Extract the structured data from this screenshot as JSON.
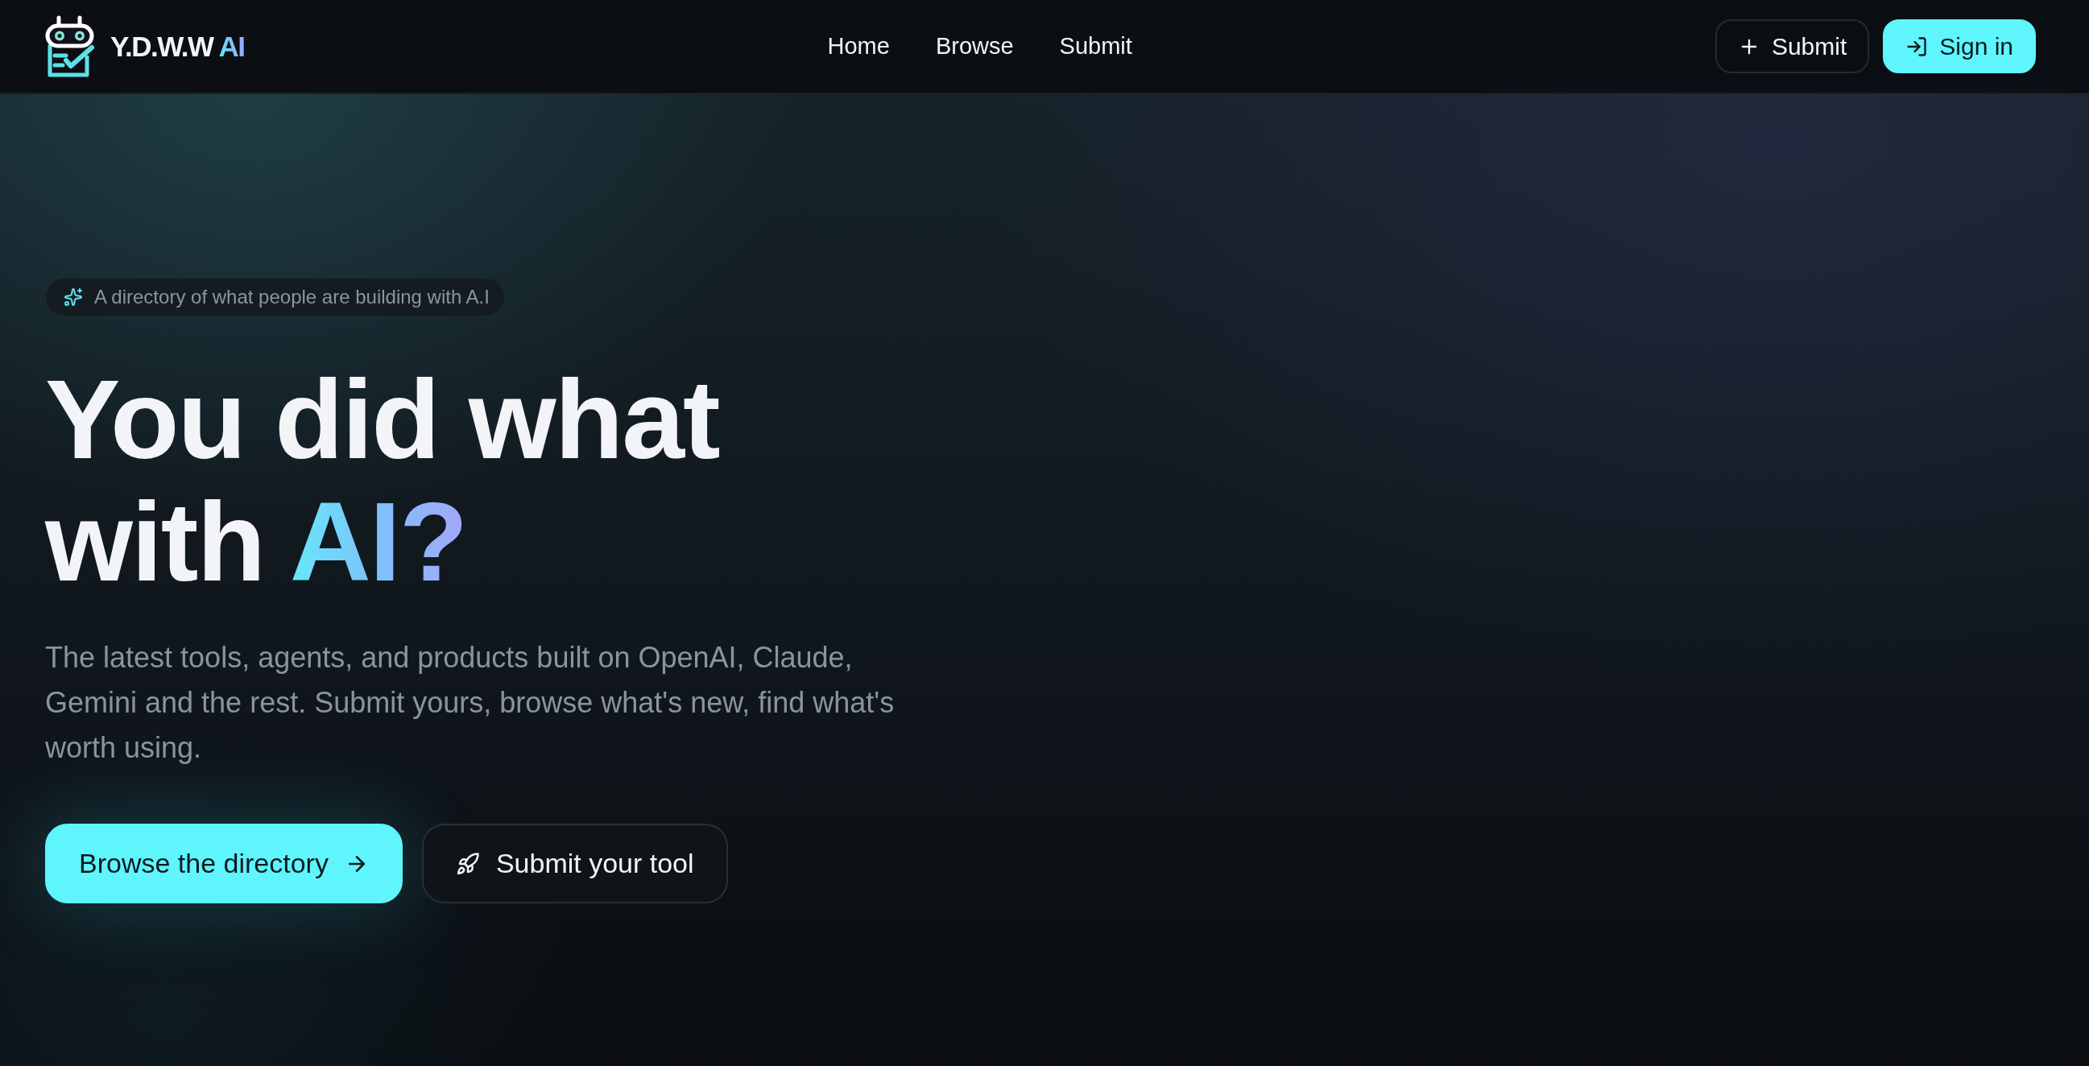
{
  "header": {
    "logo": {
      "text": "Y.D.W.W",
      "accent": "AI"
    },
    "nav": [
      {
        "label": "Home"
      },
      {
        "label": "Browse"
      },
      {
        "label": "Submit"
      }
    ],
    "actions": [
      {
        "kind": "outline",
        "label": "Submit"
      },
      {
        "kind": "primary",
        "label": "Sign in"
      }
    ]
  },
  "hero": {
    "badge": "A directory of what people are building with A.I",
    "headline": {
      "line_1": "You did what",
      "line_2": "with",
      "highlight": "AI?"
    },
    "description": "The latest tools, agents, and products built on OpenAI, Claude, Gemini and the rest. Submit yours, browse what's new, find what's worth using.",
    "buttons": [
      {
        "kind": "primary",
        "label": "Browse the directory"
      },
      {
        "kind": "outline",
        "label": "Submit your tool"
      }
    ]
  }
}
